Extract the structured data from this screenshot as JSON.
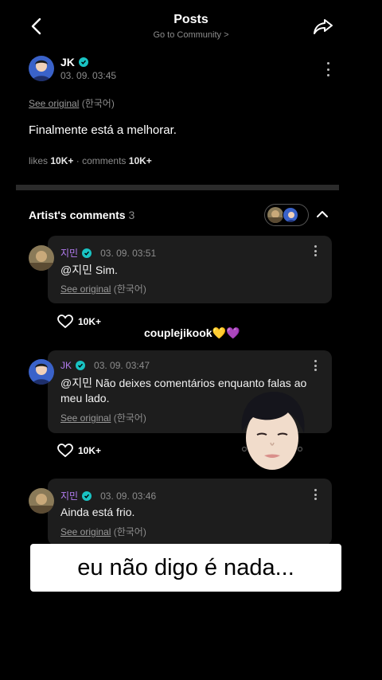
{
  "header": {
    "title": "Posts",
    "subtitle": "Go to Community >"
  },
  "post": {
    "author": "JK",
    "date": "03. 09. 03:45",
    "see_original": "See original",
    "language": "(한국어)",
    "text": "Finalmente está a melhorar.",
    "likes_label": "likes",
    "likes_value": "10K+",
    "comments_label": "· comments",
    "comments_value": "10K+"
  },
  "artist_comments": {
    "title": "Artist's comments",
    "count": "3",
    "comments": [
      {
        "author": "지민",
        "date": "03. 09. 03:51",
        "mention": "@지민",
        "text": "Sim.",
        "see_original": "See original",
        "language": "(한국어)",
        "likes": "10K+"
      },
      {
        "author": "JK",
        "date": "03. 09. 03:47",
        "mention": "@지민",
        "text": "Não deixes comentários enquanto falas ao meu lado.",
        "see_original": "See original",
        "language": "(한국어)",
        "likes": "10K+"
      },
      {
        "author": "지민",
        "date": "03. 09. 03:46",
        "mention": "",
        "text": "Ainda está frio.",
        "see_original": "See original",
        "language": "(한국어)"
      }
    ]
  },
  "watermark": "couplejikook💛💜",
  "caption": "eu não digo é nada...",
  "colors": {
    "background": "#000000",
    "card": "#1d1d1d",
    "verified": "#19c3c3",
    "name_purple": "#b37cf0"
  },
  "icons": [
    "back-arrow-icon",
    "share-icon",
    "kebab-menu-icon",
    "verified-icon",
    "heart-icon",
    "chevron-up-icon"
  ]
}
